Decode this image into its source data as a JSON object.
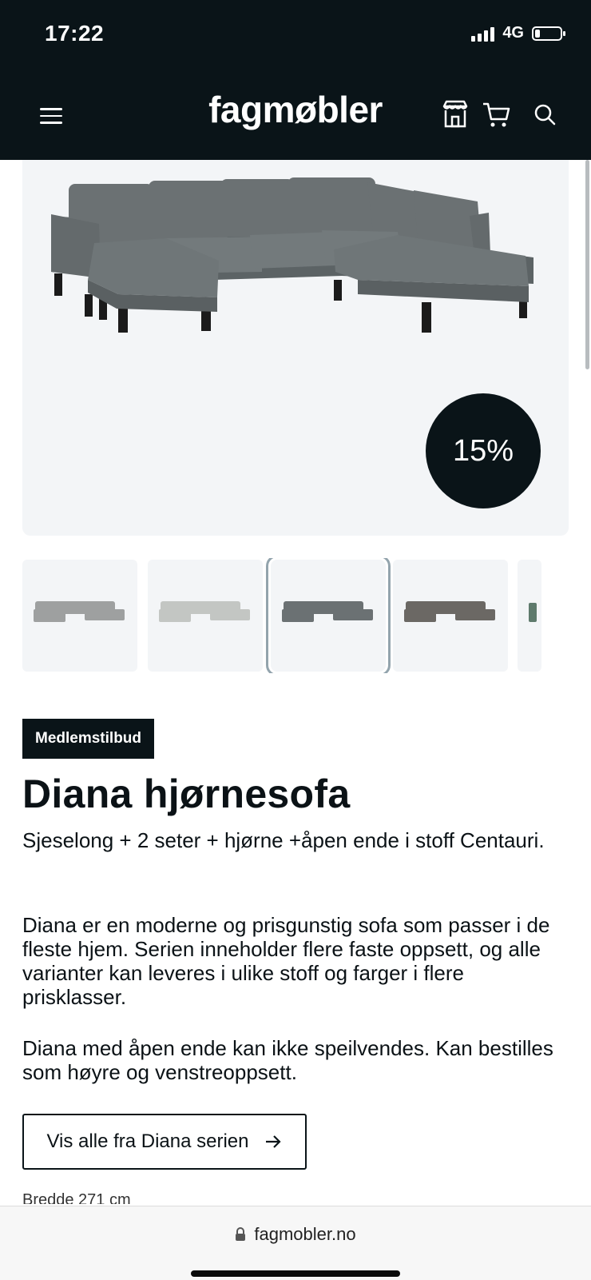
{
  "status": {
    "time": "17:22",
    "network": "4G"
  },
  "header": {
    "logo": "fagmøbler",
    "icons": [
      "menu-icon",
      "store-icon",
      "cart-icon",
      "search-icon"
    ]
  },
  "product": {
    "discount": "15%",
    "badge": "Medlemstilbud",
    "title": "Diana hjørnesofa",
    "subtitle": "Sjeselong + 2 seter + hjørne +åpen ende i stoff Centauri.",
    "description_1": "Diana er en moderne og prisgunstig sofa som passer i de fleste hjem. Serien inneholder flere faste oppsett, og alle varianter kan leveres i ulike stoff og farger i flere prisklasser.",
    "description_2": "Diana med åpen ende kan ikke speilvendes. Kan bestilles som høyre og venstreoppsett.",
    "series_button": "Vis alle fra Diana serien",
    "spec_partial": "Bredde   271 cm",
    "thumbnail_colors": [
      "#9ea0a0",
      "#c3c6c3",
      "#6b7173",
      "#6b6864",
      "#5e7a6c"
    ],
    "selected_thumbnail": 3
  },
  "browser": {
    "url": "fagmobler.no"
  },
  "colors": {
    "dark": "#0a1418",
    "image_bg": "#f3f5f7",
    "sofa_main": "#6b7173"
  }
}
